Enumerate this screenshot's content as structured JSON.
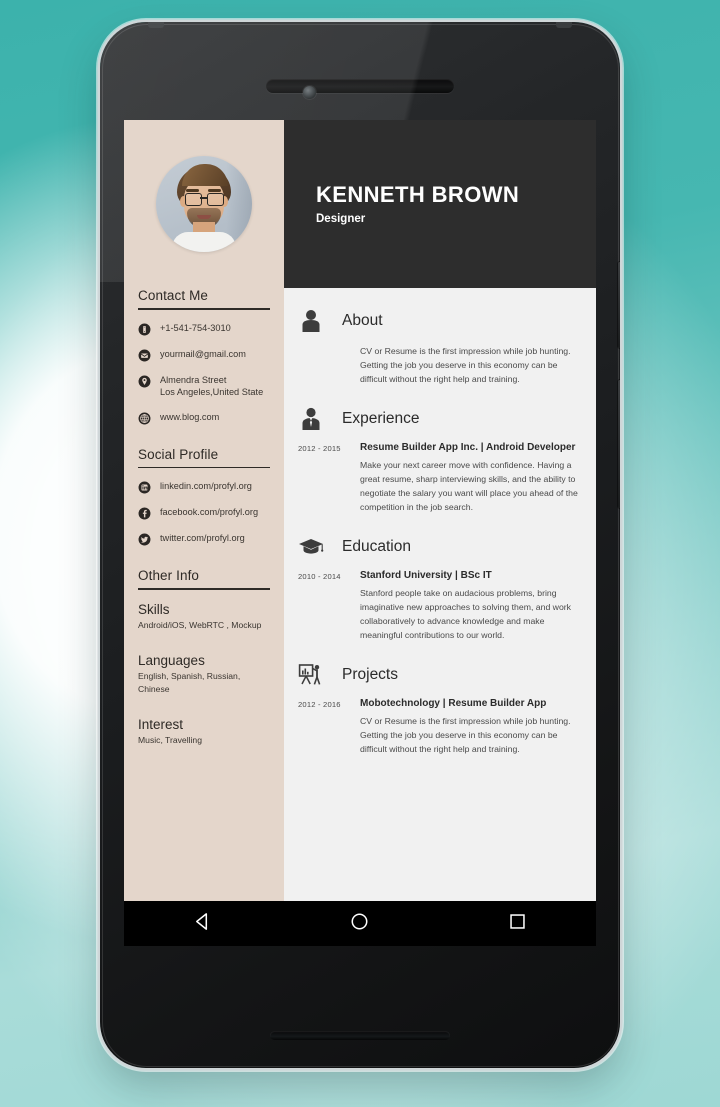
{
  "device": {
    "type": "android-phone-mockup",
    "earpiece": "speaker-grille",
    "camera": "front-camera"
  },
  "resume": {
    "header": {
      "name": "KENNETH BROWN",
      "role": "Designer",
      "avatar": "profile-photo"
    },
    "sidebar": {
      "contact": {
        "title": "Contact Me",
        "items": [
          {
            "icon": "phone-icon",
            "lines": [
              "+1-541-754-3010"
            ]
          },
          {
            "icon": "email-icon",
            "lines": [
              "yourmail@gmail.com"
            ]
          },
          {
            "icon": "location-pin-icon",
            "lines": [
              "Almendra Street",
              "Los Angeles,United State"
            ]
          },
          {
            "icon": "globe-icon",
            "lines": [
              "www.blog.com"
            ]
          }
        ]
      },
      "social": {
        "title": "Social Profile",
        "items": [
          {
            "icon": "linkedin-icon",
            "label": "linkedin.com/profyl.org"
          },
          {
            "icon": "facebook-icon",
            "label": "facebook.com/profyl.org"
          },
          {
            "icon": "twitter-icon",
            "label": "twitter.com/profyl.org"
          }
        ]
      },
      "other_info": {
        "title": "Other Info",
        "blocks": [
          {
            "heading": "Skills",
            "text": "Android/iOS, WebRTC , Mockup"
          },
          {
            "heading": "Languages",
            "text": "English, Spanish, Russian, Chinese"
          },
          {
            "heading": "Interest",
            "text": "Music, Travelling"
          }
        ]
      }
    },
    "sections": [
      {
        "id": "about",
        "icon": "person-icon",
        "title": "About",
        "body": "CV or Resume is the first impression while job hunting. Getting the job you deserve in this economy can be difficult without the right help and training."
      },
      {
        "id": "experience",
        "icon": "business-person-icon",
        "title": "Experience",
        "date": "2012 - 2015",
        "subtitle": "Resume Builder App Inc. | Android Developer",
        "body": "Make your next career move with confidence. Having a great resume, sharp interviewing skills, and the ability to negotiate the salary you want will place you ahead of the competition in the job search."
      },
      {
        "id": "education",
        "icon": "graduation-cap-icon",
        "title": "Education",
        "date": "2010 - 2014",
        "subtitle": "Stanford University | BSc IT",
        "body": "Stanford people take on audacious problems, bring imaginative new approaches to solving them, and work collaboratively to advance knowledge and make meaningful contributions to our world."
      },
      {
        "id": "projects",
        "icon": "presentation-icon",
        "title": "Projects",
        "date": "2012 - 2016",
        "subtitle": "Mobotechnology | Resume Builder App",
        "body": "CV or Resume is the first impression while job hunting. Getting the job you deserve in this economy can be difficult without the right help and training."
      }
    ]
  },
  "navbar": {
    "back": "back-triangle-icon",
    "home": "home-circle-icon",
    "recents": "recents-square-icon"
  },
  "colors": {
    "background_teal": "#3cb2ac",
    "sidebar_beige": "#e4d6cb",
    "header_dark": "#2d2d2d",
    "page_grey": "#f1f1f1",
    "text_dark": "#2b2b2b"
  }
}
